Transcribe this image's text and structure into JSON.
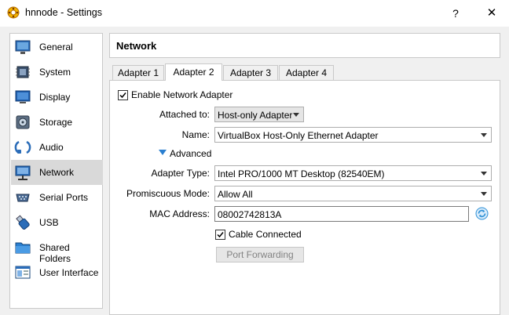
{
  "window": {
    "title": "hnnode - Settings",
    "help_label": "?",
    "close_label": "✕"
  },
  "sidebar": {
    "items": [
      {
        "label": "General",
        "icon": "general-icon"
      },
      {
        "label": "System",
        "icon": "system-icon"
      },
      {
        "label": "Display",
        "icon": "display-icon"
      },
      {
        "label": "Storage",
        "icon": "storage-icon"
      },
      {
        "label": "Audio",
        "icon": "audio-icon"
      },
      {
        "label": "Network",
        "icon": "network-icon",
        "selected": true
      },
      {
        "label": "Serial Ports",
        "icon": "serial-ports-icon"
      },
      {
        "label": "USB",
        "icon": "usb-icon"
      },
      {
        "label": "Shared Folders",
        "icon": "shared-folders-icon"
      },
      {
        "label": "User Interface",
        "icon": "user-interface-icon"
      }
    ]
  },
  "header": {
    "title": "Network"
  },
  "tabs": [
    {
      "label": "Adapter 1"
    },
    {
      "label": "Adapter 2",
      "active": true
    },
    {
      "label": "Adapter 3"
    },
    {
      "label": "Adapter 4"
    }
  ],
  "form": {
    "enable_label": "Enable Network Adapter",
    "enable_checked": true,
    "attached_label": "Attached to:",
    "attached_value": "Host-only Adapter",
    "name_label": "Name:",
    "name_value": "VirtualBox Host-Only Ethernet Adapter",
    "advanced_label": "Advanced",
    "adapter_type_label": "Adapter Type:",
    "adapter_type_value": "Intel PRO/1000 MT Desktop (82540EM)",
    "promiscuous_label": "Promiscuous Mode:",
    "promiscuous_value": "Allow All",
    "mac_label": "MAC Address:",
    "mac_value": "08002742813A",
    "cable_label": "Cable Connected",
    "cable_checked": true,
    "port_forwarding_label": "Port Forwarding"
  },
  "colors": {
    "accent": "#3b73b9",
    "selection": "#d9d9d9",
    "refresh_icon": "#2b8fd6"
  }
}
